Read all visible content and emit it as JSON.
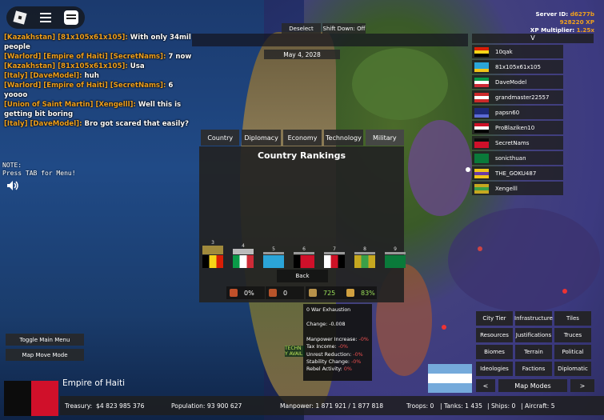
{
  "topbar": {
    "icons": [
      "roblox-logo-icon",
      "hamburger-menu-icon",
      "chat-icon"
    ],
    "deselect_label": "Deselect",
    "shift_down_label": "Shift Down: Off",
    "date": "May 4, 2028"
  },
  "server": {
    "server_id_label": "Server ID:",
    "server_id": "d6277b",
    "xp": "928220 XP",
    "xp_multiplier_label": "XP Multiplier:",
    "xp_multiplier": "1.25x"
  },
  "chat": [
    {
      "who": "[Kazakhstan] [81x105x61x105]:",
      "msg": "With only 34mil people"
    },
    {
      "who": "[Warlord] [Empire of Haiti] [SecretNams]:",
      "msg": "7 now"
    },
    {
      "who": "[Kazakhstan] [81x105x61x105]:",
      "msg": "Usa"
    },
    {
      "who": "[Italy] [DaveModel]:",
      "msg": "huh"
    },
    {
      "who": "[Warlord] [Empire of Haiti] [SecretNams]:",
      "msg": "6 yoooo"
    },
    {
      "who": "[Union of Saint Martin] [Xengelll]:",
      "msg": "Well this is getting bit boring"
    },
    {
      "who": "[Italy] [DaveModel]:",
      "msg": "Bro got scared that easily?"
    }
  ],
  "player_list": {
    "header": "V",
    "players": [
      {
        "name": "10qak",
        "flag": [
          "#d81e05",
          "#f7d417",
          "#000000"
        ]
      },
      {
        "name": "81x105x61x105",
        "flag": [
          "#2ba5d8",
          "#2ba5d8",
          "#f0c419"
        ]
      },
      {
        "name": "DaveModel",
        "flag": [
          "#0a9a48",
          "#ffffff",
          "#ce2b37"
        ]
      },
      {
        "name": "grandmaster22557",
        "flag": [
          "#cc2a2a",
          "#ffffff",
          "#cc2a2a"
        ]
      },
      {
        "name": "papsn60",
        "flag": [
          "#1e2a78",
          "#1e2a78",
          "#5c6bd6"
        ]
      },
      {
        "name": "ProBlaziken10",
        "flag": [
          "#ce1126",
          "#ffffff",
          "#000000"
        ]
      },
      {
        "name": "SecretNams",
        "flag": [
          "#0c0c0c",
          "#d0102a",
          "#d0102a"
        ]
      },
      {
        "name": "sonicthuan",
        "flag": [
          "#0a7a3a",
          "#0a7a3a",
          "#0a7a3a"
        ]
      },
      {
        "name": "THE_GOKU487",
        "flag": [
          "#f0c419",
          "#6a3aa5",
          "#f0c419"
        ]
      },
      {
        "name": "Xengelll",
        "flag": [
          "#c6a820",
          "#3aa048",
          "#c6a820"
        ]
      }
    ]
  },
  "note": {
    "line1": "NOTE:",
    "line2": "Press TAB for Menu!"
  },
  "rankings": {
    "tabs": [
      "Country",
      "Diplomacy",
      "Economy",
      "Technology",
      "Military"
    ],
    "active_tab": "Military",
    "title": "Country Rankings",
    "entries": [
      {
        "rank": "3",
        "level": 0.14,
        "bar_color": "#a08a3c",
        "flag": [
          "#000000",
          "#f7d417",
          "#d81e05"
        ]
      },
      {
        "rank": "4",
        "level": 0.06,
        "bar_color": "#bbbbbb",
        "flag": [
          "#0a9a48",
          "#ffffff",
          "#ce2b37"
        ]
      },
      {
        "rank": "5",
        "level": 0.0,
        "bar_color": "#999999",
        "flag": [
          "#2ba5d8",
          "#2ba5d8",
          "#2ba5d8"
        ]
      },
      {
        "rank": "6",
        "level": 0.0,
        "bar_color": "#999999",
        "flag": [
          "#000000",
          "#d0102a",
          "#d0102a"
        ]
      },
      {
        "rank": "7",
        "level": 0.0,
        "bar_color": "#999999",
        "flag": [
          "#ffffff",
          "#ce1126",
          "#000000"
        ]
      },
      {
        "rank": "8",
        "level": 0.0,
        "bar_color": "#999999",
        "flag": [
          "#c6a820",
          "#3aa048",
          "#c6a820"
        ]
      },
      {
        "rank": "9",
        "level": 0.0,
        "bar_color": "#999999",
        "flag": [
          "#0a7a3a",
          "#0a7a3a",
          "#0a7a3a"
        ]
      }
    ],
    "back_label": "Back",
    "stats": [
      {
        "icon": "war-exhaustion-icon",
        "value": "0%",
        "color": "#ffffff"
      },
      {
        "icon": "crossed-swords-icon",
        "value": "0",
        "color": "#ffffff"
      },
      {
        "icon": "bank-icon",
        "value": "725",
        "color": "#9be05a"
      },
      {
        "icon": "stability-icon",
        "value": "83%",
        "color": "#9be05a"
      }
    ]
  },
  "tooltip": {
    "title": "0 War Exhaustion",
    "change_label": "Change:",
    "change_value": "-0.008",
    "lines": [
      {
        "label": "Manpower Increase:",
        "value": "-0%"
      },
      {
        "label": "Tax Income:",
        "value": "-0%"
      },
      {
        "label": "Unrest Reduction:",
        "value": "-0%"
      },
      {
        "label": "Stability Change:",
        "value": "-0%"
      },
      {
        "label": "Rebel Activity:",
        "value": "0%"
      }
    ]
  },
  "tech_hint": {
    "line1": "TECHN",
    "line2": "Y AVAIL"
  },
  "left_buttons": {
    "toggle_main_menu": "Toggle Main Menu",
    "map_move_mode": "Map Move Mode"
  },
  "map_modes": {
    "buttons": [
      "City Tier",
      "Infrastructure",
      "Tiles",
      "Resources",
      "Justifications",
      "Truces",
      "Biomes",
      "Terrain",
      "Political",
      "Ideologies",
      "Factions",
      "Diplomatic"
    ],
    "prev_label": "<",
    "title": "Map Modes",
    "next_label": ">"
  },
  "country": {
    "name": "Empire of Haiti",
    "flag": [
      "#0c0c0c",
      "#d0102a"
    ],
    "treasury_label": "Treasury:",
    "treasury": "$4 823 985 376",
    "population_label": "Population:",
    "population": "93 900 627",
    "manpower_label": "Manpower:",
    "manpower": "1 871 921  /  1 877 818",
    "troops_label": "Troops:",
    "troops": "0",
    "tanks_label": "Tanks:",
    "tanks": "1 435",
    "ships_label": "Ships:",
    "ships": "0",
    "aircraft_label": "Aircraft:",
    "aircraft": "5"
  },
  "map_flag": [
    "#75aadb",
    "#ffffff",
    "#75aadb"
  ]
}
